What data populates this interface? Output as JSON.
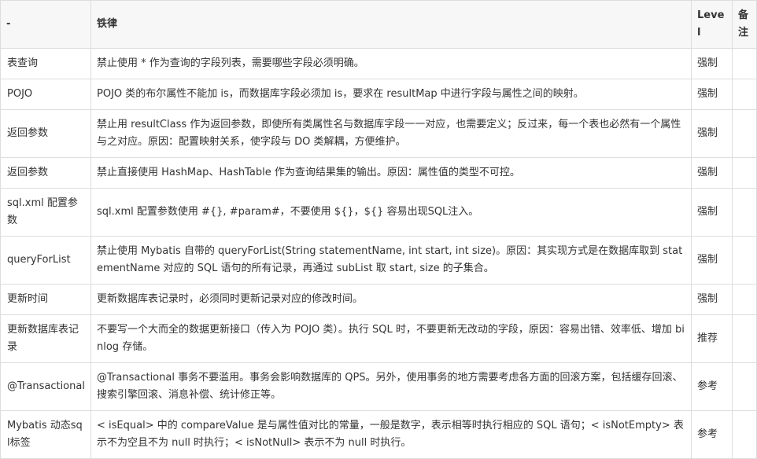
{
  "header": {
    "col0": "-",
    "col1": "铁律",
    "col2": "Level",
    "col3": "备注"
  },
  "rows": [
    {
      "category": "表查询",
      "rule": "禁止使用 * 作为查询的字段列表，需要哪些字段必须明确。",
      "level": "强制",
      "note": ""
    },
    {
      "category": "POJO",
      "rule": "POJO 类的布尔属性不能加 is，而数据库字段必须加 is，要求在 resultMap 中进行字段与属性之间的映射。",
      "level": "强制",
      "note": ""
    },
    {
      "category": "返回参数",
      "rule": "禁止用 resultClass 作为返回参数，即使所有类属性名与数据库字段一一对应，也需要定义；反过来，每一个表也必然有一个属性与之对应。原因：配置映射关系，使字段与 DO 类解耦，方便维护。",
      "level": "强制",
      "note": ""
    },
    {
      "category": "返回参数",
      "rule": "禁止直接使用 HashMap、HashTable 作为查询结果集的输出。原因：属性值的类型不可控。",
      "level": "强制",
      "note": ""
    },
    {
      "category": "sql.xml 配置参数",
      "rule": "sql.xml 配置参数使用 #{}, #param#，不要使用 ${}，${} 容易出现SQL注入。",
      "level": "强制",
      "note": ""
    },
    {
      "category": "queryForList",
      "rule": "禁止使用 Mybatis 自带的 queryForList(String statementName, int start, int size)。原因：其实现方式是在数据库取到 statementName 对应的 SQL 语句的所有记录，再通过 subList 取 start, size 的子集合。",
      "level": "强制",
      "note": ""
    },
    {
      "category": "更新时间",
      "rule": "更新数据库表记录时，必须同时更新记录对应的修改时间。",
      "level": "强制",
      "note": ""
    },
    {
      "category": "更新数据库表记录",
      "rule": "不要写一个大而全的数据更新接口（传入为 POJO 类）。执行 SQL 时，不要更新无改动的字段，原因：容易出错、效率低、增加 binlog 存储。",
      "level": "推荐",
      "note": ""
    },
    {
      "category": "@Transactional",
      "rule": "@Transactional 事务不要滥用。事务会影响数据库的 QPS。另外，使用事务的地方需要考虑各方面的回滚方案，包括缓存回滚、搜索引擎回滚、消息补偿、统计修正等。",
      "level": "参考",
      "note": ""
    },
    {
      "category": "Mybatis 动态sql标签",
      "rule": "< isEqual> 中的 compareValue 是与属性值对比的常量，一般是数字，表示相等时执行相应的 SQL 语句；< isNotEmpty> 表示不为空且不为 null 时执行；< isNotNull> 表示不为 null 时执行。",
      "level": "参考",
      "note": ""
    }
  ]
}
